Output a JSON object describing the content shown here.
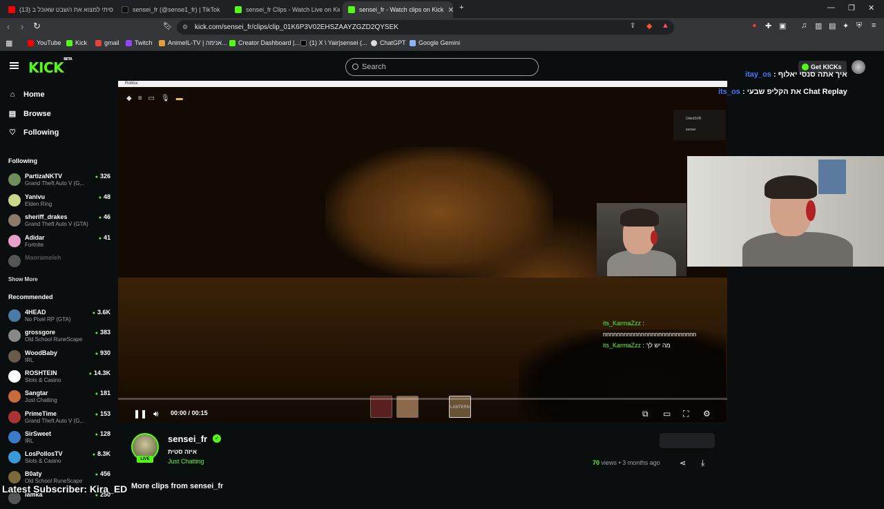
{
  "browser": {
    "tabs": [
      {
        "title": "(13) ניסיתי למצוא את השבט שאוכל ב",
        "color": "#ff0000"
      },
      {
        "title": "sensei_fr (@sense1_fr) | TikTok",
        "color": "#111111"
      },
      {
        "title": "sensei_fr Clips - Watch Live on Kick",
        "color": "#53fc18"
      },
      {
        "title": "sensei_fr - Watch clips on Kick",
        "color": "#53fc18"
      }
    ],
    "url": "kick.com/sensei_fr/clips/clip_01K6P3V02EHSZAAYZGZD2QYSEK",
    "bookmarks": [
      "YouTube",
      "Kick",
      "gmail",
      "Twitch",
      "AnimeIL-TV | אנימה...",
      "Creator Dashboard |...",
      "(1) X \\ Yair|sensei (...",
      "ChatGPT",
      "Google Gemini"
    ]
  },
  "kick": {
    "logo": "KICK",
    "logo_sup": "BETA",
    "search_placeholder": "Search",
    "get_kicks": "Get KICKs",
    "nav": {
      "home": "Home",
      "browse": "Browse",
      "following": "Following"
    },
    "following_title": "Following",
    "following": [
      {
        "name": "PartizaNKTV",
        "game": "Grand Theft Auto V (G...",
        "count": "326",
        "color": "#6b8e5a"
      },
      {
        "name": "Yanivu",
        "game": "Elden Ring",
        "count": "48",
        "color": "#c9d88a"
      },
      {
        "name": "sheriff_drakes",
        "game": "Grand Theft Auto V (GTA)",
        "count": "46",
        "color": "#8a7a6a"
      },
      {
        "name": "Adidar",
        "game": "Fortnite",
        "count": "41",
        "color": "#e8a0c8"
      },
      {
        "name": "Maorameleh",
        "game": "",
        "count": "",
        "color": "#555555"
      }
    ],
    "show_more": "Show More",
    "recommended_title": "Recommended",
    "recommended": [
      {
        "name": "4HEAD",
        "game": "No Pixel RP (GTA)",
        "count": "3.6K",
        "color": "#4a7aa8"
      },
      {
        "name": "grossgore",
        "game": "Old School RuneScape",
        "count": "383",
        "color": "#888888"
      },
      {
        "name": "WoodBaby",
        "game": "IRL",
        "count": "930",
        "color": "#6a5a4a"
      },
      {
        "name": "ROSHTEIN",
        "game": "Slots & Casino",
        "count": "14.3K",
        "color": "#ffffff"
      },
      {
        "name": "Sangtar",
        "game": "Just Chatting",
        "count": "181",
        "color": "#c86a3a"
      },
      {
        "name": "PrimeTime",
        "game": "Grand Theft Auto V (G...",
        "count": "153",
        "color": "#aa3333"
      },
      {
        "name": "SirSweet",
        "game": "IRL",
        "count": "128",
        "color": "#3a7ac8"
      },
      {
        "name": "LosPollosTV",
        "game": "Slots & Casino",
        "count": "8.3K",
        "color": "#3a9ad8"
      },
      {
        "name": "B0aty",
        "game": "Old School RuneScape",
        "count": "456",
        "color": "#7a6a3a"
      },
      {
        "name": "lamka",
        "game": "",
        "count": "250",
        "color": "#555555"
      }
    ]
  },
  "player": {
    "window_title": "Roblox",
    "current_time": "00:00",
    "duration": "00:15",
    "time_sep": "/",
    "progress": 0.0,
    "ingame_chat": [
      {
        "user": "its_KarmaZzz",
        "msg": ":"
      },
      {
        "user": "",
        "msg": "nnnnnnnnnnnnnnnnnnnnnnnnnnn"
      },
      {
        "user": "its_KarmaZzz",
        "msg": ": מה יש לך"
      }
    ],
    "hotbar": [
      "",
      "",
      "",
      "LANTERN"
    ],
    "panel_user1": "OdedSVR",
    "panel_user2": "sensei"
  },
  "stream_chat": [
    {
      "user": "itay_os",
      "msg": ": איך אתה סנסי יאלוף"
    },
    {
      "user": "its_os",
      "msg": ": את הקליפ שבעי Chat Replay"
    }
  ],
  "clip": {
    "channel": "sensei_fr",
    "title": "איזה סטית",
    "category": "Just Chatting",
    "live": "LIVE",
    "views_count": "70",
    "views_label": "views",
    "ago": "• 3 months ago",
    "more_clips": "More clips from sensei_fr"
  },
  "overlay": {
    "latest_sub": "Latest Subscriber: Kira_ED"
  }
}
